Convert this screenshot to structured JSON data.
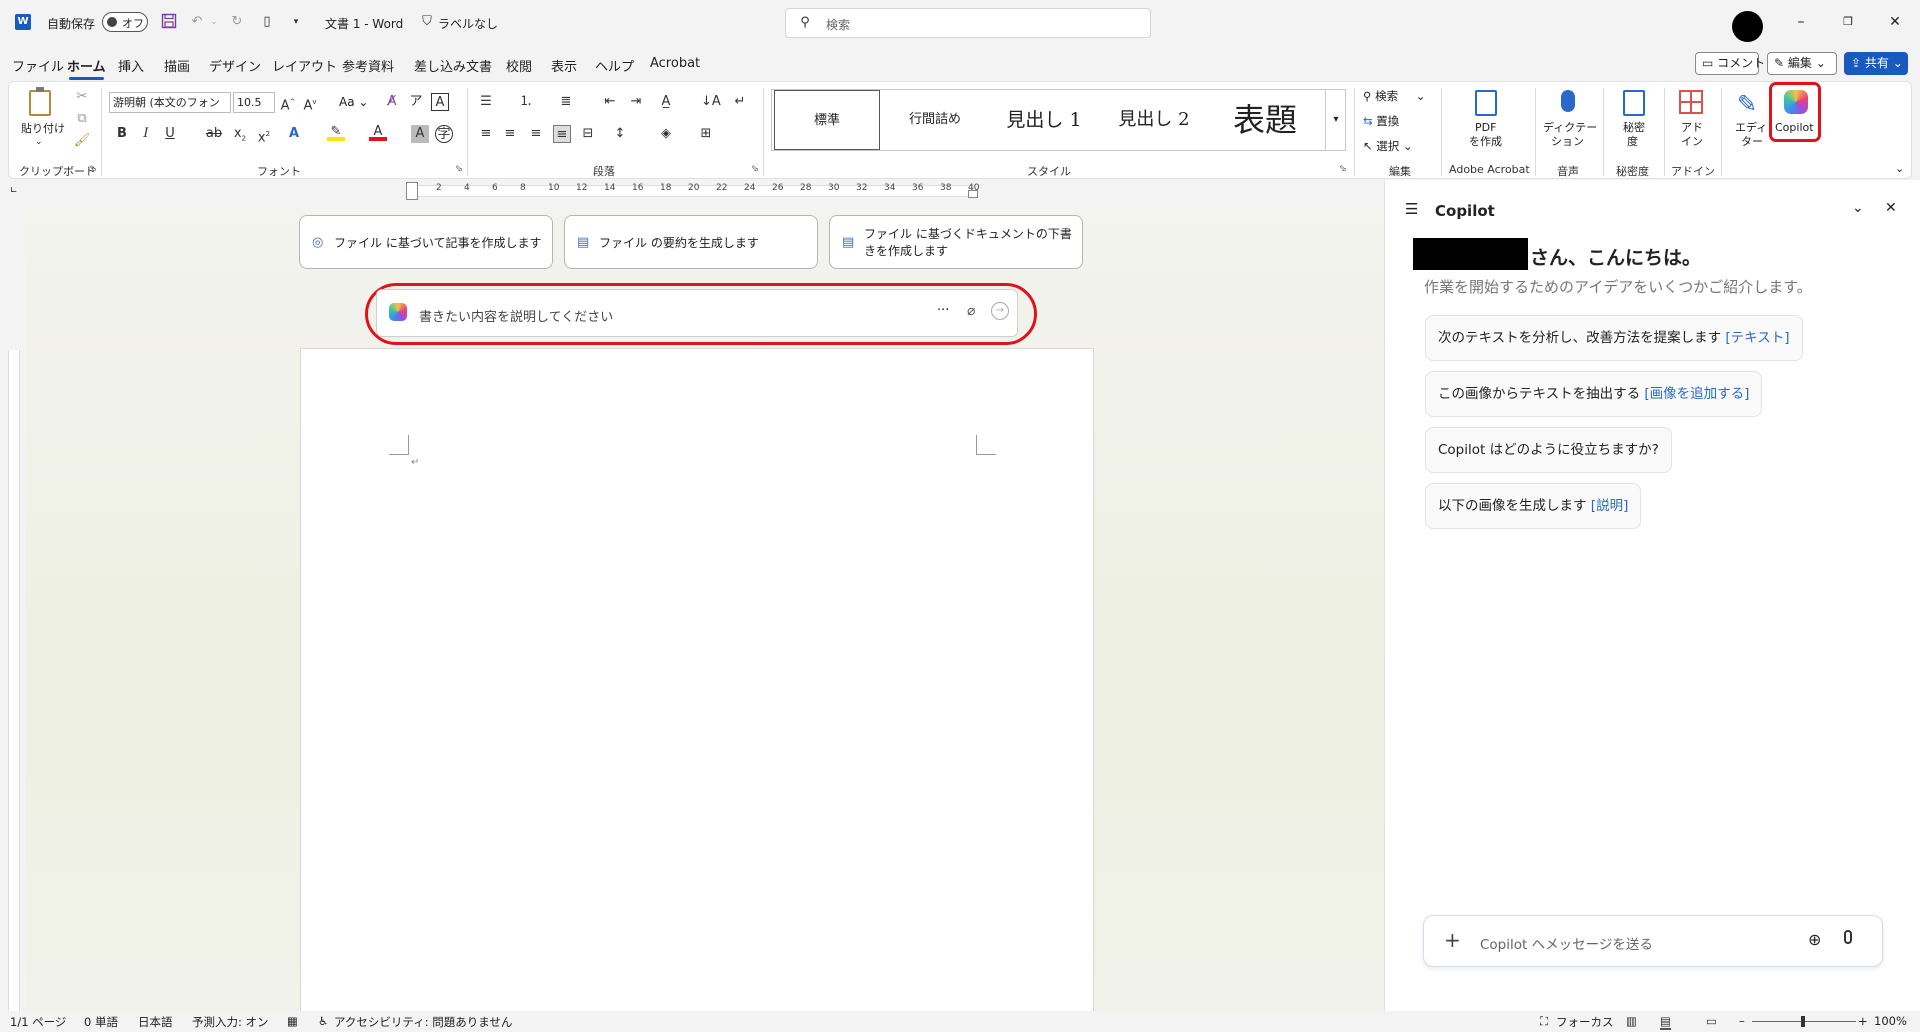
{
  "titlebar": {
    "autosave_label": "自動保存",
    "autosave_state": "オフ",
    "doc_title": "文書 1 - Word",
    "label_text": "ラベルなし",
    "search_placeholder": "検索"
  },
  "menu": {
    "tabs": [
      "ファイル",
      "ホーム",
      "挿入",
      "描画",
      "デザイン",
      "レイアウト",
      "参考資料",
      "差し込み文書",
      "校閲",
      "表示",
      "ヘルプ",
      "Acrobat"
    ],
    "active_tab": "ホーム",
    "comment_button": "コメント",
    "edit_button": "編集",
    "share_button": "共有"
  },
  "ribbon": {
    "clipboard": {
      "paste_label": "貼り付け",
      "group_label": "クリップボード"
    },
    "font": {
      "font_name": "游明朝 (本文のフォン",
      "font_size": "10.5",
      "case_button": "Aa",
      "group_label": "フォント"
    },
    "paragraph": {
      "group_label": "段落"
    },
    "styles": {
      "items": [
        "標準",
        "行間詰め",
        "見出し 1",
        "見出し 2",
        "表題"
      ],
      "group_label": "スタイル"
    },
    "editing": {
      "find": "検索",
      "replace": "置換",
      "select": "選択",
      "group_label": "編集"
    },
    "adobe": {
      "pdf_line1": "PDF",
      "pdf_line2": "を作成",
      "group_label": "Adobe Acrobat"
    },
    "voice": {
      "dictate_line1": "ディクテー",
      "dictate_line2": "ション",
      "group_label": "音声"
    },
    "sensitivity": {
      "line1": "秘密",
      "line2": "度",
      "group_label": "秘密度"
    },
    "addin": {
      "line1": "アド",
      "line2": "イン",
      "group_label": "アドイン"
    },
    "editor": {
      "line1": "エディ",
      "line2": "ター"
    },
    "copilot": {
      "label": "Copilot"
    }
  },
  "ruler": {
    "numbers": [
      "2",
      "4",
      "6",
      "8",
      "10",
      "12",
      "14",
      "16",
      "18",
      "20",
      "22",
      "24",
      "26",
      "28",
      "30",
      "32",
      "34",
      "36",
      "38",
      "40"
    ]
  },
  "document": {
    "chips": [
      "ファイル に基づいて記事を作成します",
      "ファイル の要約を生成します",
      "ファイル に基づくドキュメントの下書きを作成します"
    ],
    "prompt_placeholder": "書きたい内容を説明してください",
    "prompt_more": "···"
  },
  "copilot_pane": {
    "title": "Copilot",
    "greeting": "さん、こんにちは。",
    "subtitle": "作業を開始するためのアイデアをいくつかご紹介します。",
    "suggestions": [
      {
        "text": "次のテキストを分析し、改善方法を提案します ",
        "link": "[テキスト]"
      },
      {
        "text": "この画像からテキストを抽出する ",
        "link": "[画像を追加する]"
      },
      {
        "text": "Copilot はどのように役立ちますか?",
        "link": ""
      },
      {
        "text": "以下の画像を生成します ",
        "link": "[説明]"
      }
    ],
    "message_placeholder": "Copilot へメッセージを送る"
  },
  "statusbar": {
    "page": "1/1 ページ",
    "words": "0 単語",
    "language": "日本語",
    "predictive": "予測入力: オン",
    "accessibility": "アクセシビリティ: 問題ありません",
    "focus": "フォーカス",
    "zoom": "100%"
  },
  "colors": {
    "accent": "#185abd",
    "highlight": "#e0131a",
    "link": "#2a68c9"
  }
}
